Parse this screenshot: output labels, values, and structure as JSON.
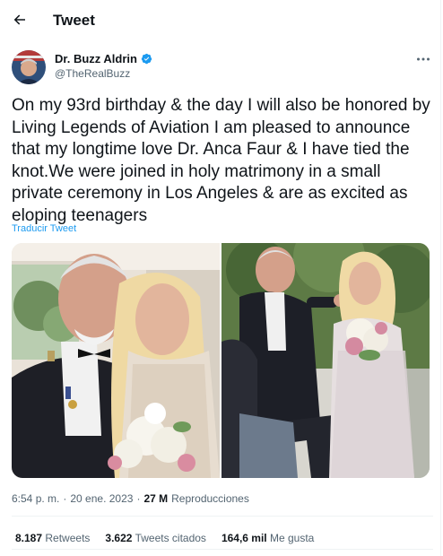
{
  "header": {
    "title": "Tweet",
    "back_icon": "arrow-left-icon"
  },
  "author": {
    "name": "Dr. Buzz Aldrin",
    "handle": "@TheRealBuzz",
    "verified": true,
    "verified_color": "#1d9bf0"
  },
  "tweet": {
    "text": "On my 93rd birthday & the day I will also be honored by Living Legends of Aviation I am pleased to announce that my longtime love Dr. Anca Faur & I have tied the knot.We were joined in holy matrimony in a small private ceremony in Los Angeles & are as excited as eloping teenagers",
    "translate_label": "Traducir Tweet"
  },
  "media": {
    "count": 2
  },
  "meta": {
    "time": "6:54 p. m.",
    "separator": "·",
    "date": "20 ene. 2023",
    "separator2": "·",
    "views_count": "27 M",
    "views_label": "Reproducciones"
  },
  "stats": {
    "retweets_count": "8.187",
    "retweets_label": "Retweets",
    "quotes_count": "3.622",
    "quotes_label": "Tweets citados",
    "likes_count": "164,6 mil",
    "likes_label": "Me gusta"
  },
  "colors": {
    "accent": "#1d9bf0",
    "text": "#0f1419",
    "secondary": "#536471",
    "border": "#eff3f4"
  }
}
